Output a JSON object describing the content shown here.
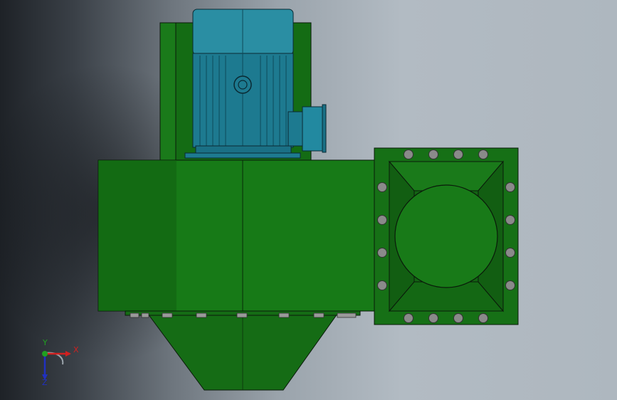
{
  "viewport": {
    "background_colors": [
      "#1e2227",
      "#6e767e",
      "#b2bbc3"
    ]
  },
  "model": {
    "body_color": "#157015",
    "motor_color": "#1f7e93",
    "bolt_color": "#8a8a8a",
    "outline_color": "#0a1a0a",
    "flange_bolt_count": 16,
    "icons": [
      "motor-icon",
      "terminal-box-icon",
      "fan-housing-icon",
      "hopper-icon",
      "outlet-flange-icon"
    ]
  },
  "triad": {
    "x_label": "X",
    "y_label": "Y",
    "z_label": "Z",
    "x_color": "#d02020",
    "y_color": "#20a020",
    "z_color": "#2030c0"
  }
}
